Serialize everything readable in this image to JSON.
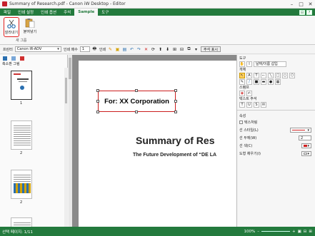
{
  "window": {
    "title": "Summary of Research.pdf - Canon iW Desktop - Editor",
    "minimize_icon": "minimize-icon",
    "maximize_icon": "maximize-icon",
    "close_icon": "close-icon"
  },
  "ribbon": {
    "tabs": [
      "파일",
      "인쇄 설정",
      "인쇄 옵션",
      "주석",
      "Sample",
      "도구"
    ],
    "active_tab": "Sample",
    "cut_label": "잘라내기",
    "paste_label": "붙여넣기",
    "group_label": "새 그룹"
  },
  "toolbar": {
    "printer_label": "프린터",
    "printer_value": "Canon iR-ADV",
    "copies_label": "인쇄 매수",
    "copies_value": "1",
    "print_label": "인쇄",
    "markup_label": "주석 표시"
  },
  "left_pane": {
    "title": "축소판 그림",
    "pages": [
      "1",
      "2",
      "2",
      "2"
    ]
  },
  "document": {
    "textbox": "For: XX Corporation",
    "title": "Summary of Res",
    "subtitle": "The Future Development of “DE LA"
  },
  "right_pane": {
    "tools_header": "도구",
    "stamp_label": "날짜/이름 삽입",
    "shapes_label": "개체",
    "stamp_section": "스탬프",
    "textnote_section": "텍스트 주석",
    "props_header": "속성",
    "props_title": "텍스처링",
    "line_style": "선 스타일(L)",
    "line_width": "선 두께(W)",
    "line_width_value": "2",
    "line_color": "선 색(C)",
    "fill_color": "도형 채우기(I)"
  },
  "status": {
    "page_text": "선택 페이지: 1/11",
    "zoom": "100%"
  },
  "colors": {
    "accent": "#237a3d",
    "highlight": "#cc1f1f"
  }
}
